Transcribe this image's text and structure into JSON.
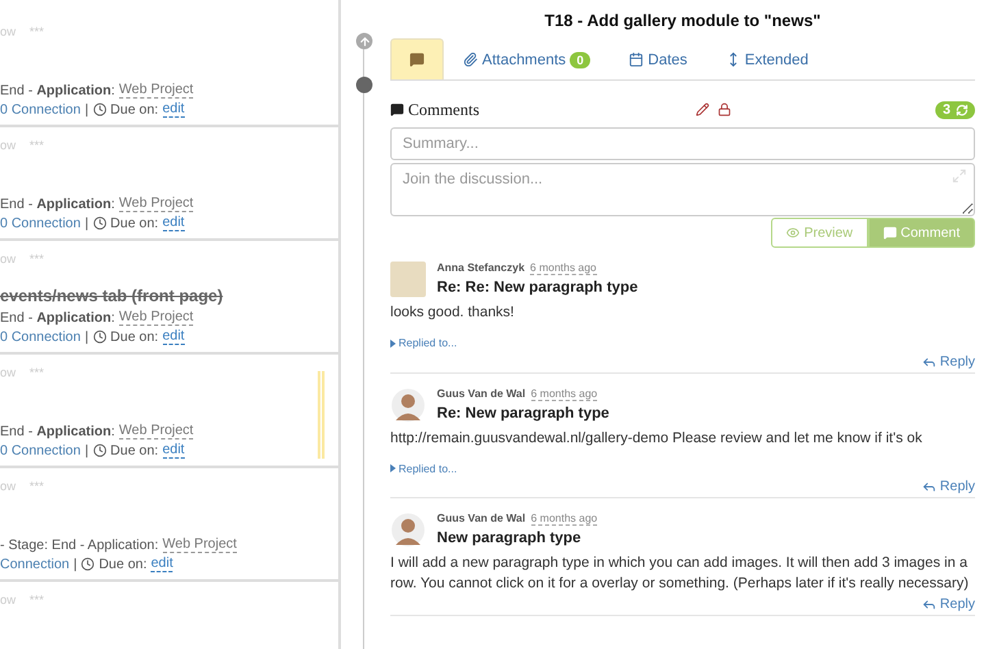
{
  "task_cards": [
    {
      "header": "ow",
      "dots": "***",
      "stage": "End - **Application**:",
      "project": "Web Project",
      "connection": "0 Connection",
      "separator": "|",
      "due_label": "Due on:",
      "due": "edit",
      "highlighted": false
    },
    {
      "header": "ow",
      "dots": "***",
      "stage": "End - **Application**:",
      "project": "Web Project",
      "connection": "0 Connection",
      "separator": "|",
      "due_label": "Due on:",
      "due": "edit",
      "highlighted": false
    },
    {
      "header": "ow",
      "dots": "***",
      "title": "events/news tab (front page)",
      "title_done": true,
      "stage": "End - **Application**:",
      "project": "Web Project",
      "connection": "0 Connection",
      "separator": "|",
      "due_label": "Due on:",
      "due": "edit",
      "highlighted": false
    },
    {
      "header": "ow",
      "dots": "***",
      "stage": "End - **Application**:",
      "project": "Web Project",
      "connection": "0 Connection",
      "separator": "|",
      "due_label": "Due on:",
      "due": "edit",
      "highlighted": true
    },
    {
      "header": "ow",
      "dots": "***",
      "stage": "- Stage: End - Application:",
      "project": "Web Project",
      "connection": "Connection",
      "separator": "|",
      "due_label": "Due on:",
      "due": "edit",
      "highlighted": false
    },
    {
      "header": "ow",
      "dots": "***",
      "highlighted": false
    }
  ],
  "detail": {
    "title": "T18 - Add gallery module to \"news\"",
    "tabs": [
      {
        "kind": "comments",
        "selected": true
      },
      {
        "kind": "attachments",
        "label": "Attachments",
        "badge": "0",
        "selected": false
      },
      {
        "kind": "dates",
        "label": "Dates",
        "selected": false
      },
      {
        "kind": "extended",
        "label": "Extended",
        "selected": false
      }
    ],
    "comments_header": {
      "label": "Comments",
      "count": "3"
    },
    "summary": {
      "placeholder": "Summary..."
    },
    "discussion": {
      "placeholder": "Join the discussion..."
    },
    "buttons": [
      {
        "kind": "preview",
        "label": "Preview"
      },
      {
        "kind": "comment",
        "label": "Comment"
      }
    ],
    "comments": [
      {
        "kind": "photo",
        "author": "Anna Stefanczyk",
        "time": "6 months ago",
        "subject": "Re: Re: New paragraph type",
        "body": "looks good. thanks!",
        "replied_to": "Replied to...",
        "reply": "Reply"
      },
      {
        "kind": "cartoon",
        "author": "Guus Van de Wal",
        "time": "6 months ago",
        "subject": "Re: New paragraph type",
        "body": "http://remain.guusvandewal.nl/gallery-demo Please review and let me know if it's ok",
        "replied_to": "Replied to...",
        "reply": "Reply"
      },
      {
        "kind": "cartoon",
        "author": "Guus Van de Wal",
        "time": "6 months ago",
        "subject": "New paragraph type",
        "body": "I will add a new paragraph type in which you can add images. It will then add 3 images in a row. You cannot click on it for a overlay or something. (Perhaps later if it's really necessary)",
        "reply": "Reply"
      }
    ]
  }
}
